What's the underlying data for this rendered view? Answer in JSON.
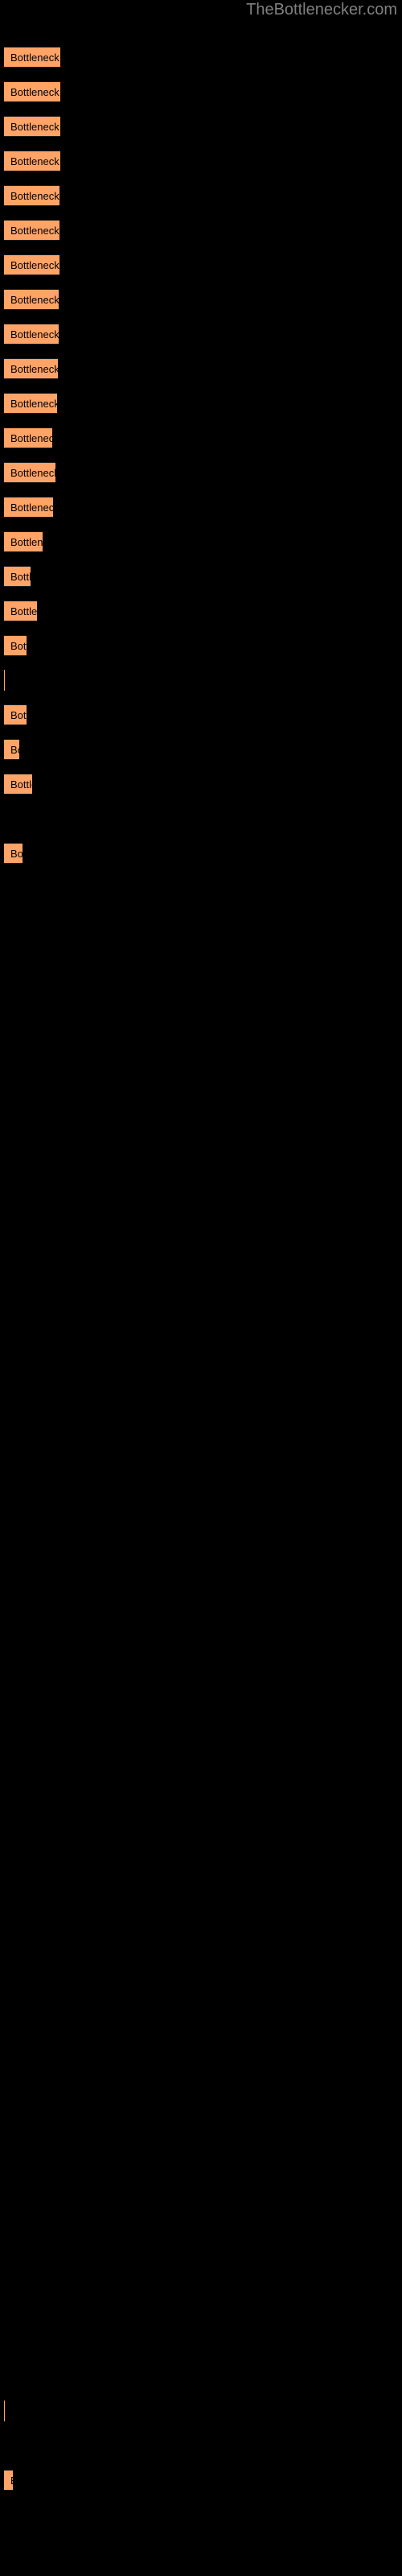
{
  "site": {
    "title": "TheBottlenecker.com",
    "title_color": "#808080"
  },
  "colors": {
    "background": "#000000",
    "bar_fill": "#ffa366",
    "bar_text": "#000000",
    "title_text": "#808080"
  },
  "bar_label": "Bottleneck result",
  "chart_data": {
    "type": "bar",
    "orientation": "horizontal",
    "title": "",
    "subtitle": "",
    "xlabel": "",
    "ylabel": "",
    "grid": false,
    "legend": null,
    "bar_color": "#ffa366",
    "background": "#000000",
    "xlim": [
      0,
      100
    ],
    "categories": [
      "Bottleneck result",
      "Bottleneck result",
      "Bottleneck result",
      "Bottleneck result",
      "Bottleneck result",
      "Bottleneck result",
      "Bottleneck result",
      "Bottleneck result",
      "Bottleneck result",
      "Bottleneck result",
      "Bottleneck result",
      "Bottleneck result",
      "Bottleneck result",
      "Bottleneck result",
      "Bottleneck result",
      "Bottleneck result",
      "Bottleneck result",
      "Bottleneck result",
      "Bottleneck result",
      "Bottleneck result",
      "Bottleneck result",
      "Bottleneck result",
      "Bottleneck result",
      "Bottleneck result",
      "Bottleneck result",
      "Bottleneck result",
      "Bottleneck result",
      "Bottleneck result",
      "Bottleneck result",
      "Bottleneck result",
      "Bottleneck result",
      "Bottleneck result",
      "Bottleneck result",
      "Bottleneck result",
      "Bottleneck result",
      "Bottleneck result",
      "Bottleneck result",
      "Bottleneck result",
      "Bottleneck result",
      "Bottleneck result",
      "Bottleneck result",
      "Bottleneck result",
      "Bottleneck result",
      "Bottleneck result",
      "Bottleneck result",
      "Bottleneck result",
      "Bottleneck result",
      "Bottleneck result",
      "Bottleneck result",
      "Bottleneck result",
      "Bottleneck result",
      "Bottleneck result",
      "Bottleneck result",
      "Bottleneck result",
      "Bottleneck result",
      "Bottleneck result",
      "Bottleneck result",
      "Bottleneck result",
      "Bottleneck result",
      "Bottleneck result",
      "Bottleneck result",
      "Bottleneck result",
      "Bottleneck result",
      "Bottleneck result",
      "Bottleneck result",
      "Bottleneck result",
      "Bottleneck result",
      "Bottleneck result",
      "Bottleneck result",
      "Bottleneck result",
      "Bottleneck result",
      "Bottleneck result",
      "Bottleneck result"
    ],
    "values": [
      70,
      70,
      70,
      70,
      69,
      69,
      69,
      68,
      68,
      67,
      66,
      60,
      64,
      61,
      48,
      33,
      41,
      28,
      1,
      28,
      19,
      35,
      0,
      23,
      0,
      0,
      0,
      0,
      0,
      0,
      0,
      0,
      0,
      0,
      0,
      0,
      0,
      0,
      0,
      0,
      0,
      0,
      0,
      0,
      0,
      0,
      0,
      0,
      0,
      0,
      0,
      0,
      0,
      0,
      0,
      0,
      0,
      0,
      0,
      0,
      0,
      0,
      0,
      0,
      0,
      0,
      0,
      0,
      1,
      0,
      11,
      0,
      0
    ]
  },
  "bars": [
    {
      "y": 58,
      "width": 70,
      "label": "Bottleneck result"
    },
    {
      "y": 101,
      "width": 70,
      "label": "Bottleneck result"
    },
    {
      "y": 144,
      "width": 70,
      "label": "Bottleneck result"
    },
    {
      "y": 187,
      "width": 70,
      "label": "Bottleneck result"
    },
    {
      "y": 230,
      "width": 69,
      "label": "Bottleneck result"
    },
    {
      "y": 273,
      "width": 69,
      "label": "Bottleneck result"
    },
    {
      "y": 316,
      "width": 69,
      "label": "Bottleneck result"
    },
    {
      "y": 359,
      "width": 68,
      "label": "Bottleneck result"
    },
    {
      "y": 402,
      "width": 68,
      "label": "Bottleneck result"
    },
    {
      "y": 445,
      "width": 67,
      "label": "Bottleneck result"
    },
    {
      "y": 488,
      "width": 66,
      "label": "Bottleneck result"
    },
    {
      "y": 531,
      "width": 60,
      "label": "Bottleneck result"
    },
    {
      "y": 574,
      "width": 64,
      "label": "Bottleneck result"
    },
    {
      "y": 617,
      "width": 61,
      "label": "Bottleneck result"
    },
    {
      "y": 660,
      "width": 48,
      "label": "Bottleneck result"
    },
    {
      "y": 703,
      "width": 33,
      "label": "Bottleneck result"
    },
    {
      "y": 746,
      "width": 41,
      "label": "Bottleneck result"
    },
    {
      "y": 789,
      "width": 28,
      "label": "Bottleneck result"
    },
    {
      "y": 832,
      "width": 1,
      "label": "Bottleneck result"
    },
    {
      "y": 875,
      "width": 28,
      "label": "Bottleneck result"
    },
    {
      "y": 918,
      "width": 19,
      "label": "Bottleneck result"
    },
    {
      "y": 961,
      "width": 35,
      "label": "Bottleneck result"
    },
    {
      "y": 1004,
      "width": 0,
      "label": "Bottleneck result"
    },
    {
      "y": 1047,
      "width": 23,
      "label": "Bottleneck result"
    },
    {
      "y": 1090,
      "width": 0,
      "label": "Bottleneck result"
    },
    {
      "y": 1133,
      "width": 0,
      "label": "Bottleneck result"
    },
    {
      "y": 1176,
      "width": 0,
      "label": "Bottleneck result"
    },
    {
      "y": 1219,
      "width": 0,
      "label": "Bottleneck result"
    },
    {
      "y": 1262,
      "width": 0,
      "label": "Bottleneck result"
    },
    {
      "y": 1305,
      "width": 0,
      "label": "Bottleneck result"
    },
    {
      "y": 1348,
      "width": 0,
      "label": "Bottleneck result"
    },
    {
      "y": 1391,
      "width": 0,
      "label": "Bottleneck result"
    },
    {
      "y": 1434,
      "width": 0,
      "label": "Bottleneck result"
    },
    {
      "y": 1477,
      "width": 0,
      "label": "Bottleneck result"
    },
    {
      "y": 1520,
      "width": 0,
      "label": "Bottleneck result"
    },
    {
      "y": 1563,
      "width": 0,
      "label": "Bottleneck result"
    },
    {
      "y": 1606,
      "width": 0,
      "label": "Bottleneck result"
    },
    {
      "y": 1649,
      "width": 0,
      "label": "Bottleneck result"
    },
    {
      "y": 1692,
      "width": 0,
      "label": "Bottleneck result"
    },
    {
      "y": 1735,
      "width": 0,
      "label": "Bottleneck result"
    },
    {
      "y": 1778,
      "width": 0,
      "label": "Bottleneck result"
    },
    {
      "y": 1821,
      "width": 0,
      "label": "Bottleneck result"
    },
    {
      "y": 1864,
      "width": 0,
      "label": "Bottleneck result"
    },
    {
      "y": 1907,
      "width": 0,
      "label": "Bottleneck result"
    },
    {
      "y": 1950,
      "width": 0,
      "label": "Bottleneck result"
    },
    {
      "y": 1993,
      "width": 0,
      "label": "Bottleneck result"
    },
    {
      "y": 2036,
      "width": 0,
      "label": "Bottleneck result"
    },
    {
      "y": 2079,
      "width": 0,
      "label": "Bottleneck result"
    },
    {
      "y": 2122,
      "width": 0,
      "label": "Bottleneck result"
    },
    {
      "y": 2165,
      "width": 0,
      "label": "Bottleneck result"
    },
    {
      "y": 2208,
      "width": 0,
      "label": "Bottleneck result"
    },
    {
      "y": 2251,
      "width": 0,
      "label": "Bottleneck result"
    },
    {
      "y": 2294,
      "width": 0,
      "label": "Bottleneck result"
    },
    {
      "y": 2337,
      "width": 0,
      "label": "Bottleneck result"
    },
    {
      "y": 2380,
      "width": 0,
      "label": "Bottleneck result"
    },
    {
      "y": 2423,
      "width": 0,
      "label": "Bottleneck result"
    },
    {
      "y": 2466,
      "width": 0,
      "label": "Bottleneck result"
    },
    {
      "y": 2509,
      "width": 0,
      "label": "Bottleneck result"
    },
    {
      "y": 2552,
      "width": 0,
      "label": "Bottleneck result"
    },
    {
      "y": 2595,
      "width": 0,
      "label": "Bottleneck result"
    },
    {
      "y": 2638,
      "width": 0,
      "label": "Bottleneck result"
    },
    {
      "y": 2681,
      "width": 0,
      "label": "Bottleneck result"
    },
    {
      "y": 2724,
      "width": 0,
      "label": "Bottleneck result"
    },
    {
      "y": 2767,
      "width": 0,
      "label": "Bottleneck result"
    },
    {
      "y": 2810,
      "width": 0,
      "label": "Bottleneck result"
    },
    {
      "y": 2853,
      "width": 0,
      "label": "Bottleneck result"
    },
    {
      "y": 2896,
      "width": 0,
      "label": "Bottleneck result"
    },
    {
      "y": 2939,
      "width": 0,
      "label": "Bottleneck result"
    },
    {
      "y": 2982,
      "width": 1,
      "label": "Bottleneck result"
    },
    {
      "y": 3025,
      "width": 0,
      "label": "Bottleneck result"
    },
    {
      "y": 3068,
      "width": 11,
      "label": "Bottleneck result"
    },
    {
      "y": 3111,
      "width": 0,
      "label": "Bottleneck result"
    },
    {
      "y": 3154,
      "width": 0,
      "label": "Bottleneck result"
    }
  ]
}
